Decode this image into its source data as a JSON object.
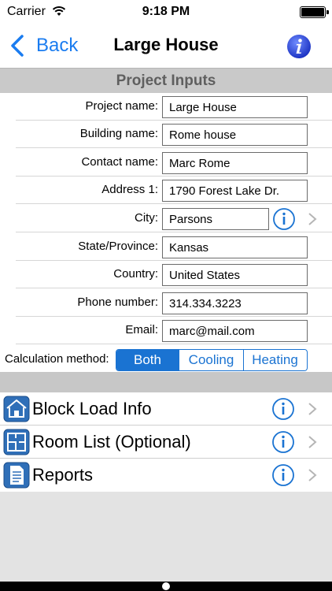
{
  "status_bar": {
    "carrier": "Carrier",
    "time": "9:18 PM"
  },
  "nav": {
    "back_label": "Back",
    "title": "Large House"
  },
  "section_title": "Project Inputs",
  "fields": [
    {
      "label": "Project name:",
      "value": "Large House"
    },
    {
      "label": "Building name:",
      "value": "Rome house"
    },
    {
      "label": "Contact name:",
      "value": "Marc Rome"
    },
    {
      "label": "Address 1:",
      "value": "1790 Forest Lake Dr."
    },
    {
      "label": "City:",
      "value": "Parsons"
    },
    {
      "label": "State/Province:",
      "value": "Kansas"
    },
    {
      "label": "Country:",
      "value": "United States"
    },
    {
      "label": "Phone number:",
      "value": "314.334.3223"
    },
    {
      "label": "Email:",
      "value": "marc@mail.com"
    }
  ],
  "calculation": {
    "label": "Calculation method:",
    "options": [
      "Both",
      "Cooling",
      "Heating"
    ],
    "selected": "Both"
  },
  "menu": [
    {
      "label": "Block Load Info",
      "icon": "house-icon"
    },
    {
      "label": "Room List (Optional)",
      "icon": "floorplan-icon"
    },
    {
      "label": "Reports",
      "icon": "document-icon"
    }
  ],
  "colors": {
    "accent": "#1a73d2",
    "link": "#1a7cf0",
    "header_bg": "#c9c9c9",
    "background": "#e3e3e3"
  }
}
